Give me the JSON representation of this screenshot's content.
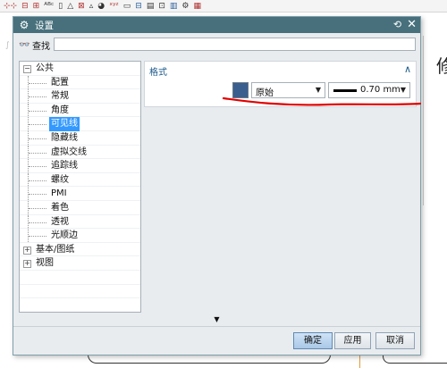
{
  "dialog": {
    "title": "设置",
    "find_label": "查找",
    "find_value": ""
  },
  "tree": [
    {
      "label": "公共",
      "expander": "−",
      "level": 0
    },
    {
      "label": "配置",
      "level": 1
    },
    {
      "label": "常规",
      "level": 1
    },
    {
      "label": "角度",
      "level": 1
    },
    {
      "label": "可见线",
      "level": 1,
      "selected": true
    },
    {
      "label": "隐藏线",
      "level": 1
    },
    {
      "label": "虚拟交线",
      "level": 1
    },
    {
      "label": "追踪线",
      "level": 1
    },
    {
      "label": "螺纹",
      "level": 1
    },
    {
      "label": "PMI",
      "level": 1
    },
    {
      "label": "着色",
      "level": 1
    },
    {
      "label": "透视",
      "level": 1
    },
    {
      "label": "光顺边",
      "level": 1
    },
    {
      "label": "基本/图纸",
      "expander": "+",
      "level": 0
    },
    {
      "label": "视图",
      "expander": "+",
      "level": 0
    }
  ],
  "format_section": {
    "title": "格式",
    "color_hex": "#3a5f8f",
    "color_value": "原始",
    "width_value": "0.70 mm"
  },
  "buttons": {
    "ok": "确定",
    "apply": "应用",
    "cancel": "取消"
  },
  "background": {
    "glyph": "修"
  },
  "colors": {
    "titlebar": "#47707c",
    "selection": "#3399ff",
    "annotation": "#e00000"
  }
}
